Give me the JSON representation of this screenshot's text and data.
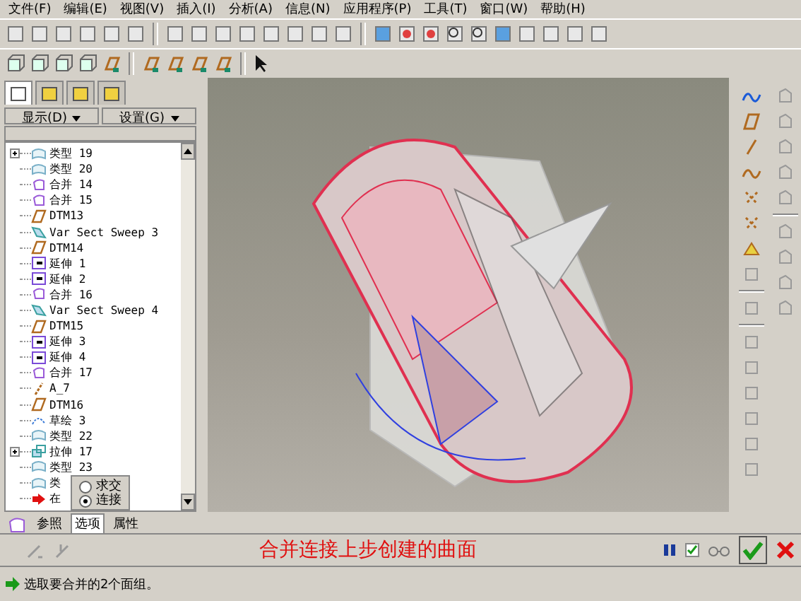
{
  "menu": [
    "文件(F)",
    "编辑(E)",
    "视图(V)",
    "插入(I)",
    "分析(A)",
    "信息(N)",
    "应用程序(P)",
    "工具(T)",
    "窗口(W)",
    "帮助(H)"
  ],
  "tree_panel": {
    "tabs": [
      {
        "selected": true
      },
      {
        "selected": false
      },
      {
        "selected": false
      },
      {
        "selected": false
      }
    ],
    "buttons": [
      "显示(D)",
      "设置(G)"
    ]
  },
  "tree": [
    {
      "label": "类型 19",
      "kind": "surface",
      "collapsed": true
    },
    {
      "label": "类型 20",
      "kind": "surface",
      "collapsed": false
    },
    {
      "label": "合并 14",
      "kind": "merge",
      "collapsed": false
    },
    {
      "label": "合并 15",
      "kind": "merge",
      "collapsed": false
    },
    {
      "label": "DTM13",
      "kind": "plane",
      "collapsed": false
    },
    {
      "label": "Var Sect Sweep 3",
      "kind": "sweep",
      "collapsed": false
    },
    {
      "label": "DTM14",
      "kind": "plane",
      "collapsed": false
    },
    {
      "label": "延伸 1",
      "kind": "extend",
      "collapsed": false
    },
    {
      "label": "延伸 2",
      "kind": "extend",
      "collapsed": false
    },
    {
      "label": "合并 16",
      "kind": "merge",
      "collapsed": false
    },
    {
      "label": "Var Sect Sweep 4",
      "kind": "sweep",
      "collapsed": false
    },
    {
      "label": "DTM15",
      "kind": "plane",
      "collapsed": false
    },
    {
      "label": "延伸 3",
      "kind": "extend",
      "collapsed": false
    },
    {
      "label": "延伸 4",
      "kind": "extend",
      "collapsed": false
    },
    {
      "label": "合并 17",
      "kind": "merge",
      "collapsed": false
    },
    {
      "label": "A_7",
      "kind": "axis",
      "collapsed": false
    },
    {
      "label": "DTM16",
      "kind": "plane",
      "collapsed": false
    },
    {
      "label": "草绘 3",
      "kind": "sketch",
      "collapsed": false
    },
    {
      "label": "类型 22",
      "kind": "surface",
      "collapsed": false
    },
    {
      "label": "拉伸 17",
      "kind": "extrude",
      "collapsed": true
    },
    {
      "label": "类型 23",
      "kind": "surface",
      "collapsed": false
    },
    {
      "label": "类",
      "kind": "surface",
      "collapsed": false
    },
    {
      "label": "在",
      "kind": "insert",
      "collapsed": false
    }
  ],
  "options_popup": {
    "options": [
      {
        "label": "求交",
        "selected": false
      },
      {
        "label": "连接",
        "selected": true
      }
    ]
  },
  "dashboard": {
    "tabs": [
      {
        "label": "参照",
        "selected": false
      },
      {
        "label": "选项",
        "selected": true
      },
      {
        "label": "属性",
        "selected": false
      }
    ],
    "caption": "合并连接上步创建的曲面",
    "preview_checked": true
  },
  "status": "选取要合并的2个面组。"
}
